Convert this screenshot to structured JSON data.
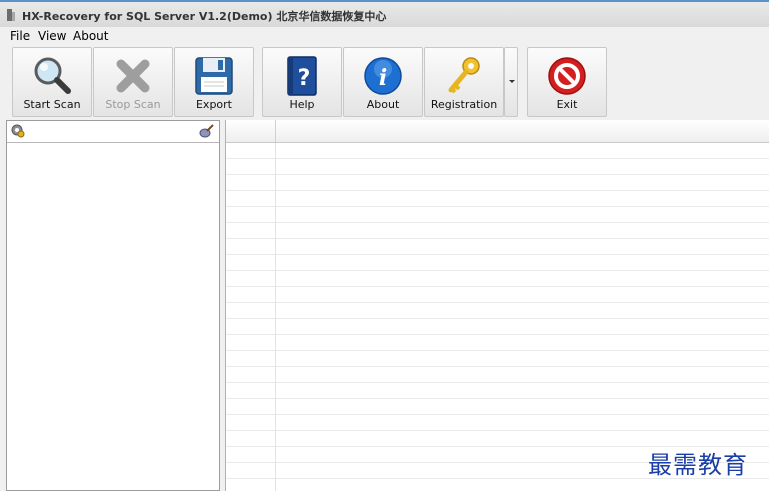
{
  "window": {
    "title": "HX-Recovery for SQL Server V1.2(Demo) 北京华信数据恢复中心"
  },
  "menu": {
    "items": [
      {
        "label": "File"
      },
      {
        "label": "View"
      },
      {
        "label": "About"
      }
    ]
  },
  "toolbar": {
    "start_scan": "Start Scan",
    "stop_scan": "Stop Scan",
    "export": "Export",
    "help": "Help",
    "about": "About",
    "registration": "Registration",
    "exit": "Exit",
    "stop_scan_enabled": false
  },
  "icons": {
    "start_scan": "magnifier-icon",
    "stop_scan": "x-cross-icon",
    "export": "floppy-disk-icon",
    "help": "help-book-icon",
    "about": "info-icon",
    "registration": "key-icon",
    "exit": "no-entry-icon",
    "tree_header_left": "gear-search-icon",
    "tree_header_right": "brush-icon"
  },
  "colors": {
    "title_accent": "#5b93c8",
    "watermark": "#1a3ea8",
    "exit_red": "#d51f1f",
    "about_blue": "#1d6fd1"
  },
  "watermark": {
    "text": "最需教育"
  }
}
